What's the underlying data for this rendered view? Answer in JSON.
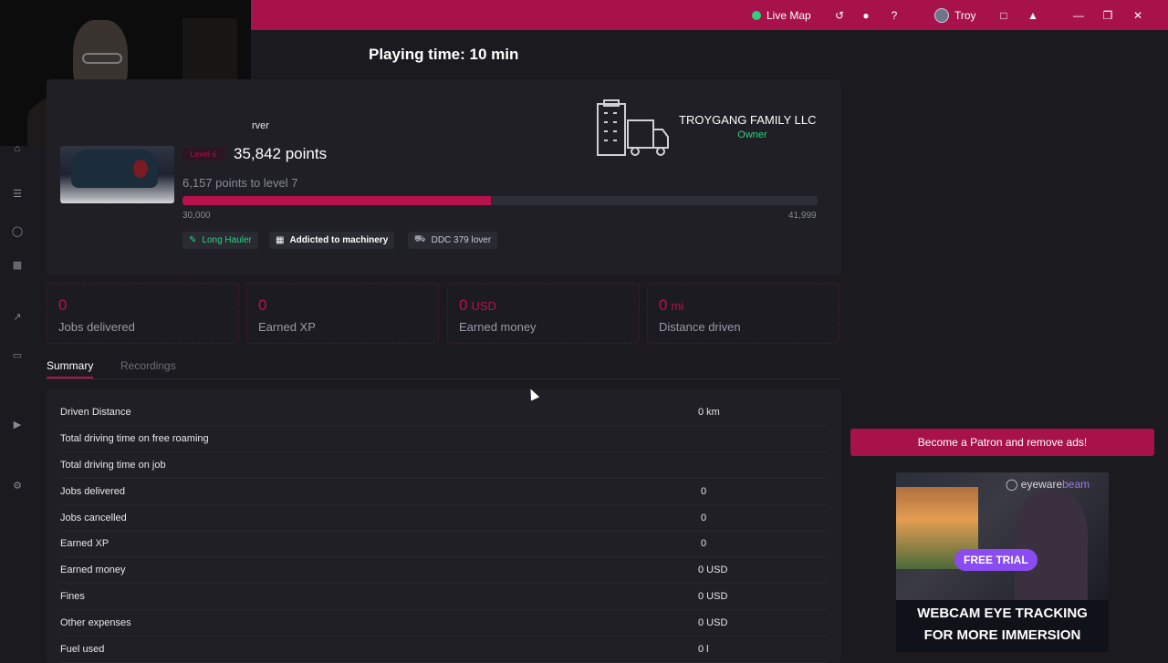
{
  "topbar": {
    "live_map": "Live Map",
    "user": "Troy",
    "icons": [
      "share-icon",
      "globe-icon",
      "help-icon",
      "chat-icon",
      "bell-icon",
      "minimize-icon",
      "restore-icon",
      "close-icon"
    ]
  },
  "page": {
    "title": "Playing time: 10 min"
  },
  "profile": {
    "server_suffix": "rver",
    "level_badge": "Level 6",
    "points": "35,842 points",
    "to_next_level": "6,157 points to level 7",
    "progress_fraction": 0.486,
    "progress_min": "30,000",
    "progress_max": "41,999",
    "badges": [
      {
        "label": "Long Hauler",
        "icon": "pencil-icon",
        "color": "#2bd17e"
      },
      {
        "label": "Addicted to machinery",
        "icon": "machinery-icon",
        "color": "#ffffff"
      },
      {
        "label": "DDC 379 lover",
        "icon": "truck-icon",
        "color": "#c8c8d0"
      }
    ]
  },
  "company": {
    "name": "TROYGANG FAMILY LLC",
    "role": "Owner"
  },
  "stats": [
    {
      "value": "0",
      "unit": "",
      "label": "Jobs delivered"
    },
    {
      "value": "0",
      "unit": "",
      "label": "Earned XP"
    },
    {
      "value": "0",
      "unit": "USD",
      "label": "Earned money"
    },
    {
      "value": "0",
      "unit": "mi",
      "label": "Distance driven"
    }
  ],
  "tabs": {
    "summary": "Summary",
    "recordings": "Recordings"
  },
  "summary_rows": [
    {
      "key": "Driven Distance",
      "value": "0 km"
    },
    {
      "key": "Total driving time on free roaming",
      "value": ""
    },
    {
      "key": "Total driving time on job",
      "value": ""
    },
    {
      "key": "Jobs delivered",
      "value": "0"
    },
    {
      "key": "Jobs cancelled",
      "value": "0"
    },
    {
      "key": "Earned XP",
      "value": "0"
    },
    {
      "key": "Earned money",
      "value": "0 USD"
    },
    {
      "key": "Fines",
      "value": "0 USD"
    },
    {
      "key": "Other expenses",
      "value": "0 USD"
    },
    {
      "key": "Fuel used",
      "value": "0 l"
    }
  ],
  "ads": {
    "patron": "Become a Patron and remove ads!",
    "brand_a": "eyeware",
    "brand_b": "beam",
    "cta": "FREE TRIAL",
    "headline_1": "WEBCAM EYE TRACKING",
    "headline_2": "FOR MORE IMMERSION"
  },
  "colors": {
    "accent": "#a8124a",
    "success": "#2bd17e",
    "bg": "#1a1a1f"
  }
}
